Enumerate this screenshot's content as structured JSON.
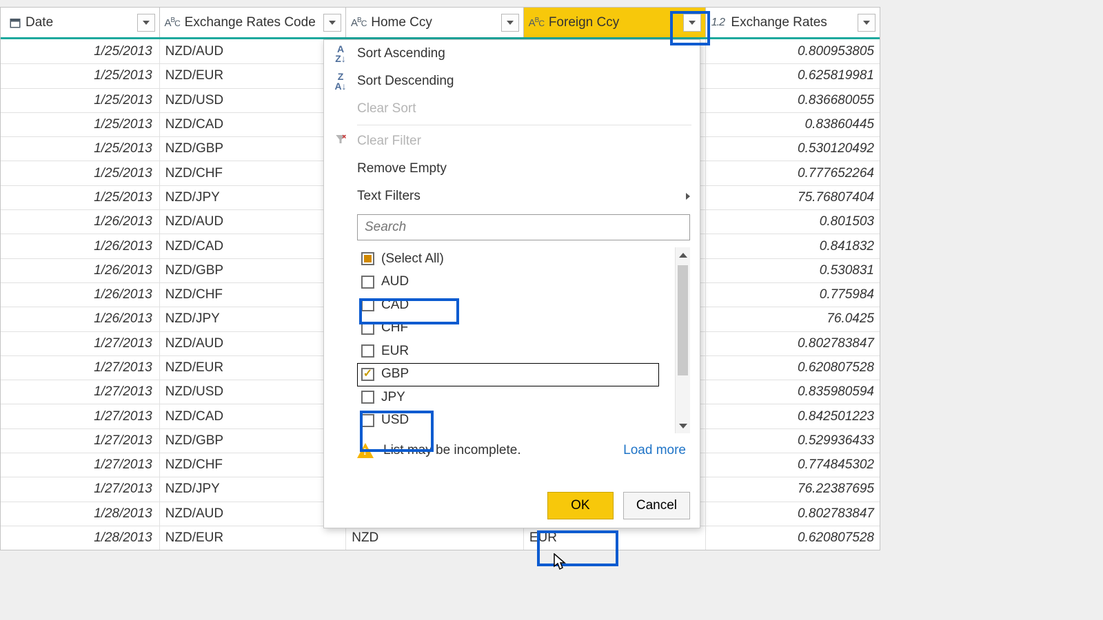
{
  "columns": {
    "date": {
      "label": "Date"
    },
    "code": {
      "label": "Exchange Rates Code"
    },
    "home": {
      "label": "Home Ccy"
    },
    "foreign": {
      "label": "Foreign Ccy"
    },
    "rate": {
      "label": "Exchange Rates"
    }
  },
  "rows": [
    {
      "date": "1/25/2013",
      "code": "NZD/AUD",
      "home": "",
      "foreign": "",
      "rate": "0.800953805"
    },
    {
      "date": "1/25/2013",
      "code": "NZD/EUR",
      "home": "",
      "foreign": "",
      "rate": "0.625819981"
    },
    {
      "date": "1/25/2013",
      "code": "NZD/USD",
      "home": "",
      "foreign": "",
      "rate": "0.836680055"
    },
    {
      "date": "1/25/2013",
      "code": "NZD/CAD",
      "home": "",
      "foreign": "",
      "rate": "0.83860445"
    },
    {
      "date": "1/25/2013",
      "code": "NZD/GBP",
      "home": "",
      "foreign": "",
      "rate": "0.530120492"
    },
    {
      "date": "1/25/2013",
      "code": "NZD/CHF",
      "home": "",
      "foreign": "",
      "rate": "0.777652264"
    },
    {
      "date": "1/25/2013",
      "code": "NZD/JPY",
      "home": "",
      "foreign": "",
      "rate": "75.76807404"
    },
    {
      "date": "1/26/2013",
      "code": "NZD/AUD",
      "home": "",
      "foreign": "",
      "rate": "0.801503"
    },
    {
      "date": "1/26/2013",
      "code": "NZD/CAD",
      "home": "",
      "foreign": "",
      "rate": "0.841832"
    },
    {
      "date": "1/26/2013",
      "code": "NZD/GBP",
      "home": "",
      "foreign": "",
      "rate": "0.530831"
    },
    {
      "date": "1/26/2013",
      "code": "NZD/CHF",
      "home": "",
      "foreign": "",
      "rate": "0.775984"
    },
    {
      "date": "1/26/2013",
      "code": "NZD/JPY",
      "home": "",
      "foreign": "",
      "rate": "76.0425"
    },
    {
      "date": "1/27/2013",
      "code": "NZD/AUD",
      "home": "",
      "foreign": "",
      "rate": "0.802783847"
    },
    {
      "date": "1/27/2013",
      "code": "NZD/EUR",
      "home": "",
      "foreign": "",
      "rate": "0.620807528"
    },
    {
      "date": "1/27/2013",
      "code": "NZD/USD",
      "home": "",
      "foreign": "",
      "rate": "0.835980594"
    },
    {
      "date": "1/27/2013",
      "code": "NZD/CAD",
      "home": "",
      "foreign": "",
      "rate": "0.842501223"
    },
    {
      "date": "1/27/2013",
      "code": "NZD/GBP",
      "home": "",
      "foreign": "",
      "rate": "0.529936433"
    },
    {
      "date": "1/27/2013",
      "code": "NZD/CHF",
      "home": "",
      "foreign": "",
      "rate": "0.774845302"
    },
    {
      "date": "1/27/2013",
      "code": "NZD/JPY",
      "home": "",
      "foreign": "",
      "rate": "76.22387695"
    },
    {
      "date": "1/28/2013",
      "code": "NZD/AUD",
      "home": "",
      "foreign": "",
      "rate": "0.802783847"
    },
    {
      "date": "1/28/2013",
      "code": "NZD/EUR",
      "home": "NZD",
      "foreign": "EUR",
      "rate": "0.620807528"
    }
  ],
  "menu": {
    "sort_asc": "Sort Ascending",
    "sort_desc": "Sort Descending",
    "clear_sort": "Clear Sort",
    "clear_filter": "Clear Filter",
    "remove_empty": "Remove Empty",
    "text_filters": "Text Filters",
    "search_placeholder": "Search",
    "select_all": "(Select All)",
    "options": [
      {
        "label": "AUD",
        "checked": false
      },
      {
        "label": "CAD",
        "checked": false
      },
      {
        "label": "CHF",
        "checked": false
      },
      {
        "label": "EUR",
        "checked": false
      },
      {
        "label": "GBP",
        "checked": true
      },
      {
        "label": "JPY",
        "checked": false
      },
      {
        "label": "USD",
        "checked": false
      }
    ],
    "warn": "List may be incomplete.",
    "load_more": "Load more",
    "ok": "OK",
    "cancel": "Cancel"
  },
  "type_abc": "A",
  "type_num": "1.2"
}
